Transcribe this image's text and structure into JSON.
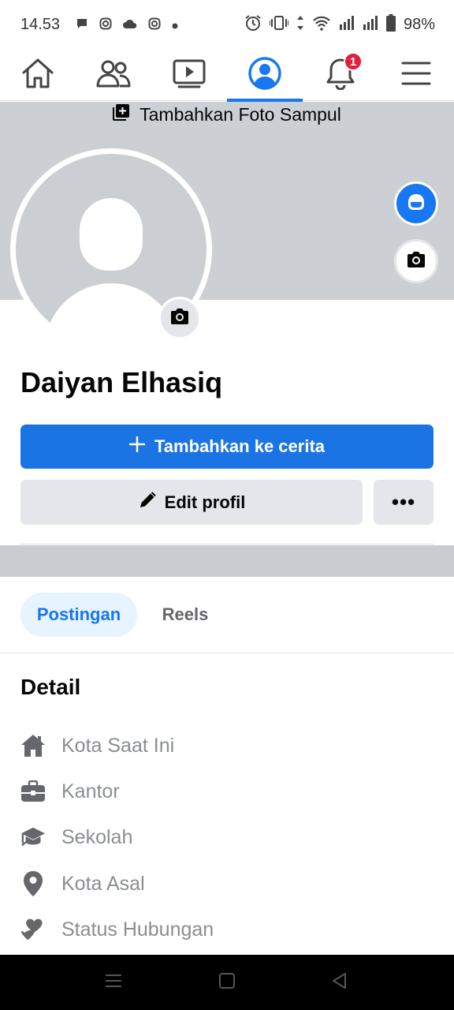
{
  "status_bar": {
    "time": "14.53",
    "battery": "98%",
    "icons_left": [
      "chat-bubble-icon",
      "instagram-icon",
      "cloud-icon",
      "instagram-icon",
      "dot-icon"
    ],
    "icons_right": [
      "alarm-icon",
      "vibrate-icon",
      "data-arrows-icon",
      "wifi-icon",
      "signal-icon",
      "signal-icon",
      "battery-icon"
    ]
  },
  "top_nav": {
    "items": [
      {
        "name": "home",
        "icon": "home-icon"
      },
      {
        "name": "friends",
        "icon": "friends-icon"
      },
      {
        "name": "watch",
        "icon": "video-icon"
      },
      {
        "name": "profile",
        "icon": "profile-icon",
        "active": true
      },
      {
        "name": "notifications",
        "icon": "bell-icon",
        "badge": "1"
      },
      {
        "name": "menu",
        "icon": "hamburger-icon"
      }
    ],
    "notification_badge": "1"
  },
  "cover": {
    "add_label": "Tambahkan Foto Sampul"
  },
  "profile": {
    "name": "Daiyan Elhasiq"
  },
  "actions": {
    "add_story_label": "Tambahkan ke cerita",
    "edit_profile_label": "Edit profil",
    "more_label": "•••"
  },
  "tabs": [
    {
      "label": "Postingan",
      "active": true
    },
    {
      "label": "Reels",
      "active": false
    }
  ],
  "detail": {
    "title": "Detail",
    "items": [
      {
        "label": "Kota Saat Ini",
        "icon": "house-icon"
      },
      {
        "label": "Kantor",
        "icon": "briefcase-icon"
      },
      {
        "label": "Sekolah",
        "icon": "graduation-cap-icon"
      },
      {
        "label": "Kota Asal",
        "icon": "location-pin-icon"
      },
      {
        "label": "Status Hubungan",
        "icon": "hearts-icon"
      }
    ]
  },
  "colors": {
    "accent": "#1877f2",
    "button_primary": "#1b74e4",
    "button_secondary": "#e4e6eb",
    "badge": "#e41e3f",
    "cover": "#ccd0d5",
    "muted_text": "#8a8d91"
  }
}
